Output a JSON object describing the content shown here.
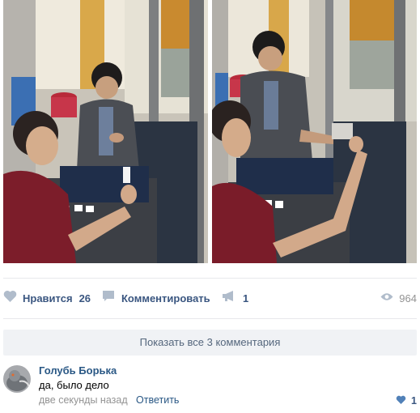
{
  "post": {
    "photos": [
      {
        "alt": "photo-1"
      },
      {
        "alt": "photo-2"
      }
    ],
    "actions": {
      "like_label": "Нравится",
      "like_count": "26",
      "comment_label": "Комментировать",
      "share_count": "1",
      "views_count": "964"
    },
    "icons": {
      "like": "heart-icon",
      "comment": "comment-icon",
      "share": "megaphone-icon",
      "views": "eye-icon"
    },
    "colors": {
      "action_text": "#3a5680",
      "icon": "#b0bccb",
      "link": "#2a5885",
      "muted": "#939393",
      "like_active": "#5181b8"
    }
  },
  "comments": {
    "show_all_label": "Показать все 3 комментария",
    "items": [
      {
        "author": "Голубь Борька",
        "text": "да, было дело",
        "time": "две секунды назад",
        "reply_label": "Ответить",
        "likes": "1"
      }
    ]
  }
}
